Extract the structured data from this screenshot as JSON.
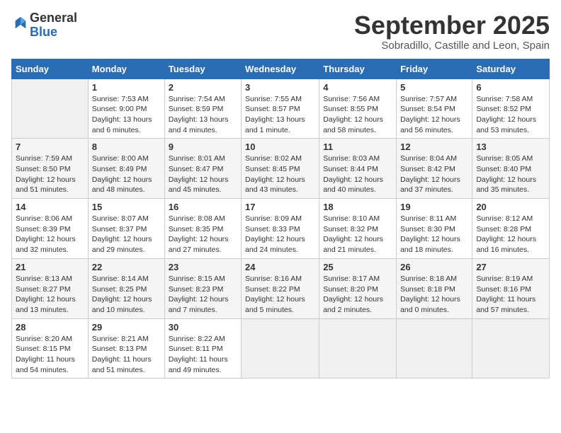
{
  "logo": {
    "text_general": "General",
    "text_blue": "Blue"
  },
  "title": "September 2025",
  "subtitle": "Sobradillo, Castille and Leon, Spain",
  "days_of_week": [
    "Sunday",
    "Monday",
    "Tuesday",
    "Wednesday",
    "Thursday",
    "Friday",
    "Saturday"
  ],
  "weeks": [
    [
      {
        "day": "",
        "info": ""
      },
      {
        "day": "1",
        "info": "Sunrise: 7:53 AM\nSunset: 9:00 PM\nDaylight: 13 hours\nand 6 minutes."
      },
      {
        "day": "2",
        "info": "Sunrise: 7:54 AM\nSunset: 8:59 PM\nDaylight: 13 hours\nand 4 minutes."
      },
      {
        "day": "3",
        "info": "Sunrise: 7:55 AM\nSunset: 8:57 PM\nDaylight: 13 hours\nand 1 minute."
      },
      {
        "day": "4",
        "info": "Sunrise: 7:56 AM\nSunset: 8:55 PM\nDaylight: 12 hours\nand 58 minutes."
      },
      {
        "day": "5",
        "info": "Sunrise: 7:57 AM\nSunset: 8:54 PM\nDaylight: 12 hours\nand 56 minutes."
      },
      {
        "day": "6",
        "info": "Sunrise: 7:58 AM\nSunset: 8:52 PM\nDaylight: 12 hours\nand 53 minutes."
      }
    ],
    [
      {
        "day": "7",
        "info": "Sunrise: 7:59 AM\nSunset: 8:50 PM\nDaylight: 12 hours\nand 51 minutes."
      },
      {
        "day": "8",
        "info": "Sunrise: 8:00 AM\nSunset: 8:49 PM\nDaylight: 12 hours\nand 48 minutes."
      },
      {
        "day": "9",
        "info": "Sunrise: 8:01 AM\nSunset: 8:47 PM\nDaylight: 12 hours\nand 45 minutes."
      },
      {
        "day": "10",
        "info": "Sunrise: 8:02 AM\nSunset: 8:45 PM\nDaylight: 12 hours\nand 43 minutes."
      },
      {
        "day": "11",
        "info": "Sunrise: 8:03 AM\nSunset: 8:44 PM\nDaylight: 12 hours\nand 40 minutes."
      },
      {
        "day": "12",
        "info": "Sunrise: 8:04 AM\nSunset: 8:42 PM\nDaylight: 12 hours\nand 37 minutes."
      },
      {
        "day": "13",
        "info": "Sunrise: 8:05 AM\nSunset: 8:40 PM\nDaylight: 12 hours\nand 35 minutes."
      }
    ],
    [
      {
        "day": "14",
        "info": "Sunrise: 8:06 AM\nSunset: 8:39 PM\nDaylight: 12 hours\nand 32 minutes."
      },
      {
        "day": "15",
        "info": "Sunrise: 8:07 AM\nSunset: 8:37 PM\nDaylight: 12 hours\nand 29 minutes."
      },
      {
        "day": "16",
        "info": "Sunrise: 8:08 AM\nSunset: 8:35 PM\nDaylight: 12 hours\nand 27 minutes."
      },
      {
        "day": "17",
        "info": "Sunrise: 8:09 AM\nSunset: 8:33 PM\nDaylight: 12 hours\nand 24 minutes."
      },
      {
        "day": "18",
        "info": "Sunrise: 8:10 AM\nSunset: 8:32 PM\nDaylight: 12 hours\nand 21 minutes."
      },
      {
        "day": "19",
        "info": "Sunrise: 8:11 AM\nSunset: 8:30 PM\nDaylight: 12 hours\nand 18 minutes."
      },
      {
        "day": "20",
        "info": "Sunrise: 8:12 AM\nSunset: 8:28 PM\nDaylight: 12 hours\nand 16 minutes."
      }
    ],
    [
      {
        "day": "21",
        "info": "Sunrise: 8:13 AM\nSunset: 8:27 PM\nDaylight: 12 hours\nand 13 minutes."
      },
      {
        "day": "22",
        "info": "Sunrise: 8:14 AM\nSunset: 8:25 PM\nDaylight: 12 hours\nand 10 minutes."
      },
      {
        "day": "23",
        "info": "Sunrise: 8:15 AM\nSunset: 8:23 PM\nDaylight: 12 hours\nand 7 minutes."
      },
      {
        "day": "24",
        "info": "Sunrise: 8:16 AM\nSunset: 8:22 PM\nDaylight: 12 hours\nand 5 minutes."
      },
      {
        "day": "25",
        "info": "Sunrise: 8:17 AM\nSunset: 8:20 PM\nDaylight: 12 hours\nand 2 minutes."
      },
      {
        "day": "26",
        "info": "Sunrise: 8:18 AM\nSunset: 8:18 PM\nDaylight: 12 hours\nand 0 minutes."
      },
      {
        "day": "27",
        "info": "Sunrise: 8:19 AM\nSunset: 8:16 PM\nDaylight: 11 hours\nand 57 minutes."
      }
    ],
    [
      {
        "day": "28",
        "info": "Sunrise: 8:20 AM\nSunset: 8:15 PM\nDaylight: 11 hours\nand 54 minutes."
      },
      {
        "day": "29",
        "info": "Sunrise: 8:21 AM\nSunset: 8:13 PM\nDaylight: 11 hours\nand 51 minutes."
      },
      {
        "day": "30",
        "info": "Sunrise: 8:22 AM\nSunset: 8:11 PM\nDaylight: 11 hours\nand 49 minutes."
      },
      {
        "day": "",
        "info": ""
      },
      {
        "day": "",
        "info": ""
      },
      {
        "day": "",
        "info": ""
      },
      {
        "day": "",
        "info": ""
      }
    ]
  ]
}
